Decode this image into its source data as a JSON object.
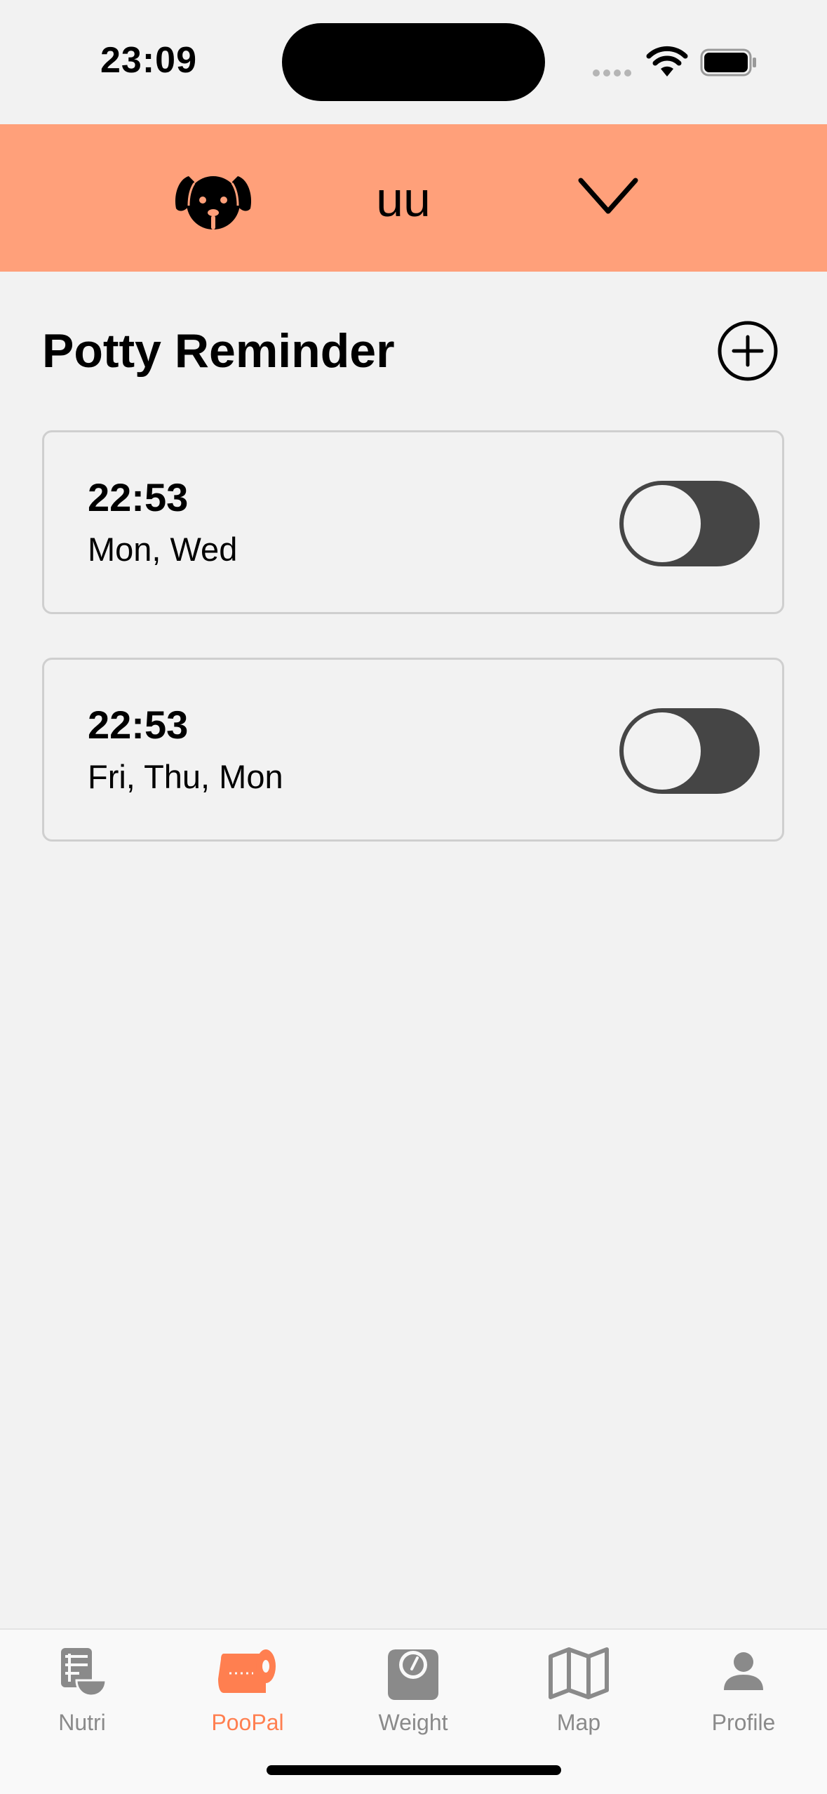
{
  "status_bar": {
    "time": "23:09"
  },
  "pet_selector": {
    "name": "uu",
    "avatar_icon": "dog-face-icon",
    "dropdown_icon": "chevron-down-icon"
  },
  "page": {
    "title": "Potty Reminder",
    "add_icon": "plus-circle-icon"
  },
  "reminders": [
    {
      "time": "22:53",
      "days": "Mon, Wed",
      "enabled": false
    },
    {
      "time": "22:53",
      "days": "Fri, Thu, Mon",
      "enabled": false
    }
  ],
  "tab_bar": {
    "active": "PooPal",
    "tabs": [
      {
        "label": "Nutri",
        "icon": "food-list-icon"
      },
      {
        "label": "PooPal",
        "icon": "toilet-roll-icon"
      },
      {
        "label": "Weight",
        "icon": "scale-icon"
      },
      {
        "label": "Map",
        "icon": "map-icon"
      },
      {
        "label": "Profile",
        "icon": "person-icon"
      }
    ]
  },
  "colors": {
    "header": "#ffa07a",
    "accent": "#ff7f50",
    "toggle_track": "#454545",
    "background": "#f2f2f2",
    "tab_inactive": "#8a8a8a"
  }
}
